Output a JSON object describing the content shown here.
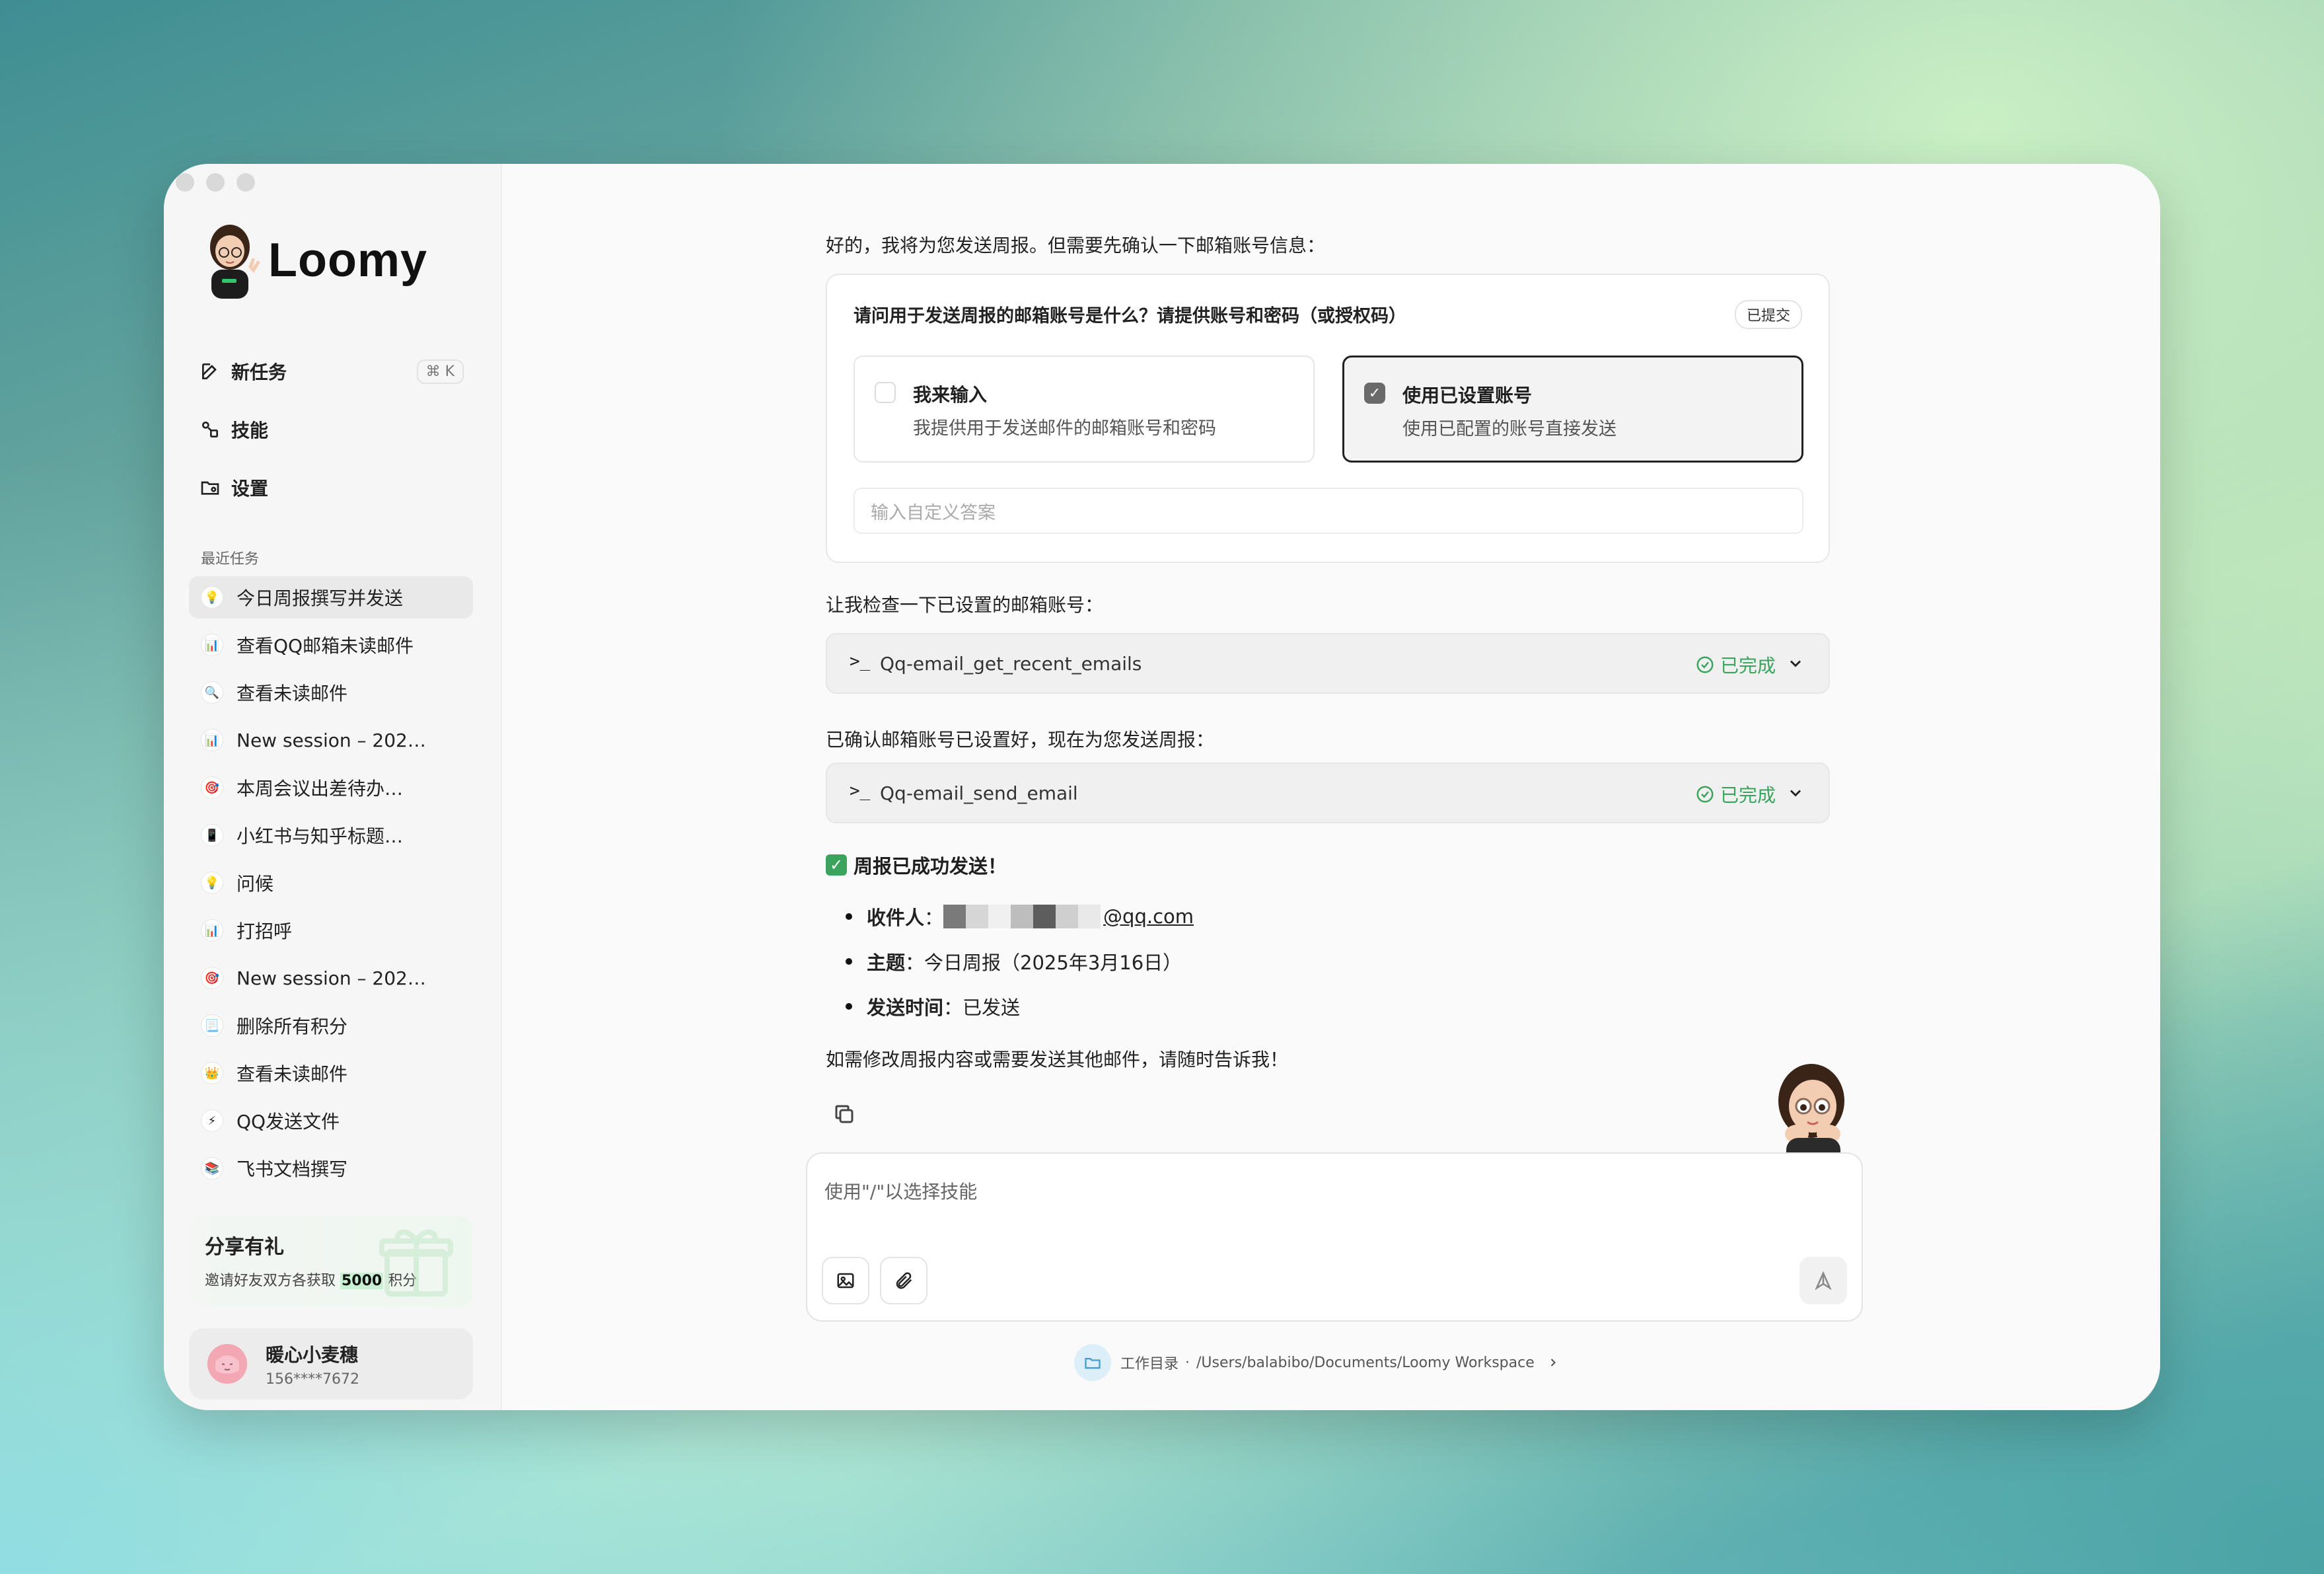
{
  "app": {
    "name": "Loomy"
  },
  "nav": {
    "new_task": "新任务",
    "new_task_shortcut": "⌘ K",
    "skills": "技能",
    "settings": "设置"
  },
  "recent": {
    "label": "最近任务",
    "items": [
      {
        "label": "今日周报撰写并发送",
        "icon": "💡"
      },
      {
        "label": "查看QQ邮箱未读邮件",
        "icon": "📊"
      },
      {
        "label": "查看未读邮件",
        "icon": "🔍"
      },
      {
        "label": "New session – 202…",
        "icon": "📊"
      },
      {
        "label": "本周会议出差待办…",
        "icon": "🎯"
      },
      {
        "label": "小红书与知乎标题…",
        "icon": "📱"
      },
      {
        "label": "问候",
        "icon": "💡"
      },
      {
        "label": "打招呼",
        "icon": "📊"
      },
      {
        "label": "New session – 202…",
        "icon": "🎯"
      },
      {
        "label": "删除所有积分",
        "icon": "📃"
      },
      {
        "label": "查看未读邮件",
        "icon": "👑"
      },
      {
        "label": "QQ发送文件",
        "icon": "⚡"
      },
      {
        "label": "飞书文档撰写",
        "icon": "📚"
      }
    ]
  },
  "promo": {
    "title": "分享有礼",
    "sub_prefix": "邀请好友双方各获取 ",
    "points": "5000",
    "sub_suffix": " 积分"
  },
  "user": {
    "name": "暖心小麦穗",
    "phone": "156****7672"
  },
  "chat": {
    "intro": "好的，我将为您发送周报。但需要先确认一下邮箱账号信息：",
    "question": {
      "title": "请问用于发送周报的邮箱账号是什么？请提供账号和密码（或授权码）",
      "badge": "已提交",
      "options": [
        {
          "title": "我来输入",
          "desc": "我提供用于发送邮件的邮箱账号和密码",
          "selected": false
        },
        {
          "title": "使用已设置账号",
          "desc": "使用已配置的账号直接发送",
          "selected": true
        }
      ],
      "custom_placeholder": "输入自定义答案"
    },
    "check_text": "让我检查一下已设置的邮箱账号：",
    "tool1": {
      "prompt": ">_",
      "name": "Qq-email_get_recent_emails",
      "status": "已完成"
    },
    "confirm_text": "已确认邮箱账号已设置好，现在为您发送周报：",
    "tool2": {
      "prompt": ">_",
      "name": "Qq-email_send_email",
      "status": "已完成"
    },
    "done_title": "周报已成功发送！",
    "recipient_label": "收件人",
    "recipient_value": "@qq.com",
    "subject_label": "主题",
    "subject_value": "今日周报（2025年3月16日）",
    "time_label": "发送时间",
    "time_value": "已发送",
    "closing": "如需修改周报内容或需要发送其他邮件，请随时告诉我！"
  },
  "composer": {
    "placeholder": "使用\"/\"以选择技能"
  },
  "workdir": {
    "label": "工作目录",
    "separator": "·",
    "path": "/Users/balabibo/Documents/Loomy Workspace"
  },
  "colors": {
    "success": "#3aa35c",
    "accent_dark": "#222222"
  }
}
